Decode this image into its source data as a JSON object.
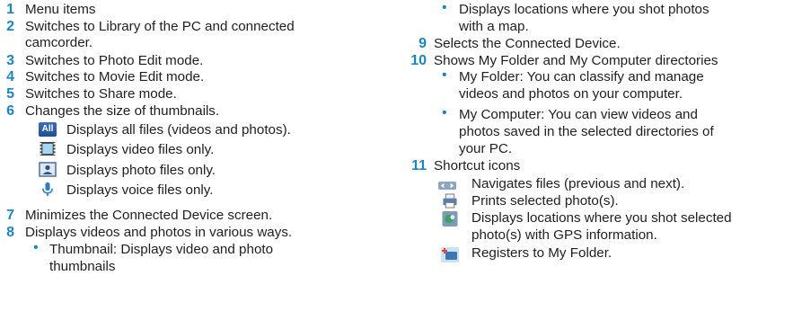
{
  "left": {
    "items": [
      {
        "num": "1",
        "text": "Menu items"
      },
      {
        "num": "2",
        "line1": "Switches to Library of the PC and connected",
        "line2": "camcorder."
      },
      {
        "num": "3",
        "text": "Switches to Photo Edit mode."
      },
      {
        "num": "4",
        "text": "Switches to Movie Edit mode."
      },
      {
        "num": "5",
        "text": "Switches to Share mode."
      },
      {
        "num": "6",
        "text": "Changes the size of thumbnails."
      },
      {
        "num": "7",
        "text": "Minimizes the Connected Device screen."
      },
      {
        "num": "8",
        "text": "Displays videos and photos in various ways."
      }
    ],
    "filters": [
      {
        "icon": "all-files-icon",
        "text": "Displays all files (videos and photos)."
      },
      {
        "icon": "video-files-icon",
        "text": "Displays video files only."
      },
      {
        "icon": "photo-files-icon",
        "text": "Displays photo files only."
      },
      {
        "icon": "voice-files-icon",
        "text": "Displays voice files only."
      }
    ],
    "all_icon_label": "All",
    "thumb_bullet": {
      "line1": "Thumbnail: Displays video and photo",
      "line2": "thumbnails"
    }
  },
  "right": {
    "map_bullet": {
      "line1": "Displays locations where you shot photos",
      "line2": "with a map."
    },
    "item9": {
      "num": "9",
      "text": "Selects the Connected Device."
    },
    "item10": {
      "num": "10",
      "text": "Shows My Folder and My Computer directories"
    },
    "myfolder": {
      "line1": "My Folder: You can classify and manage",
      "line2": "videos and photos on your computer."
    },
    "mycomputer": {
      "line1": "My Computer: You can view videos and",
      "line2": "photos saved in the selected directories of",
      "line3": "your PC."
    },
    "item11": {
      "num": "11",
      "text": "Shortcut icons"
    },
    "shortcuts": [
      {
        "icon": "navigate-icon",
        "text": "Navigates files (previous and next)."
      },
      {
        "icon": "print-icon",
        "text": "Prints selected photo(s)."
      },
      {
        "icon": "gps-location-icon",
        "line1": "Displays locations where you shot selected",
        "line2": "photo(s) with GPS information."
      },
      {
        "icon": "register-folder-icon",
        "text": "Registers to My Folder."
      }
    ]
  },
  "colors": {
    "accent": "#1a86c8",
    "text": "#1f1f1f"
  }
}
